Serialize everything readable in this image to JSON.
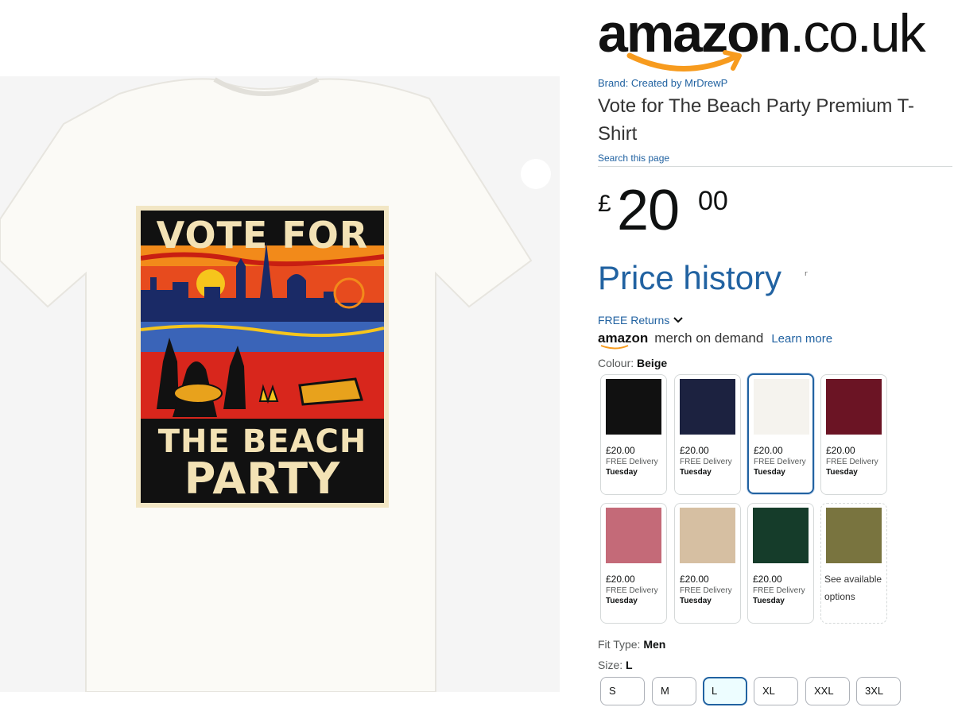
{
  "product_image": {
    "design_text": {
      "top": "VOTE FOR",
      "middle": "THE BEACH",
      "bottom": "PARTY"
    }
  },
  "header": {
    "logo_main": "amazon",
    "logo_tld": ".co.uk"
  },
  "product": {
    "brand": "Brand: Created by MrDrewP",
    "title": "Vote for The Beach Party Premium T-Shirt",
    "search_link": "Search this page"
  },
  "price": {
    "symbol": "£",
    "whole": "20",
    "fraction": "00"
  },
  "price_history": {
    "label": "Price history",
    "mark": "r"
  },
  "delivery": {
    "free_returns": "FREE Returns",
    "merch_brand": "amazon",
    "merch_text": "merch on demand",
    "learn_more": "Learn more"
  },
  "colour": {
    "label": "Colour: ",
    "selected": "Beige",
    "options": [
      {
        "color": "#111111",
        "price": "£20.00",
        "delivery": "FREE Delivery",
        "day": "Tuesday"
      },
      {
        "color": "#1c2240",
        "price": "£20.00",
        "delivery": "FREE Delivery",
        "day": "Tuesday"
      },
      {
        "color": "#f5f3ee",
        "price": "£20.00",
        "delivery": "FREE Delivery",
        "day": "Tuesday"
      },
      {
        "color": "#6b1424",
        "price": "£20.00",
        "delivery": "FREE Delivery",
        "day": "Tuesday"
      },
      {
        "color": "#c46a78",
        "price": "£20.00",
        "delivery": "FREE Delivery",
        "day": "Tuesday"
      },
      {
        "color": "#d6bfa2",
        "price": "£20.00",
        "delivery": "FREE Delivery",
        "day": "Tuesday"
      },
      {
        "color": "#153c2a",
        "price": "£20.00",
        "delivery": "FREE Delivery",
        "day": "Tuesday"
      },
      {
        "color": "#79743f",
        "see_options": "See available options"
      }
    ]
  },
  "fit": {
    "label": "Fit Type: ",
    "value": "Men"
  },
  "size": {
    "label": "Size: ",
    "value": "L",
    "options": [
      "S",
      "M",
      "L",
      "XL",
      "XXL",
      "3XL"
    ]
  }
}
